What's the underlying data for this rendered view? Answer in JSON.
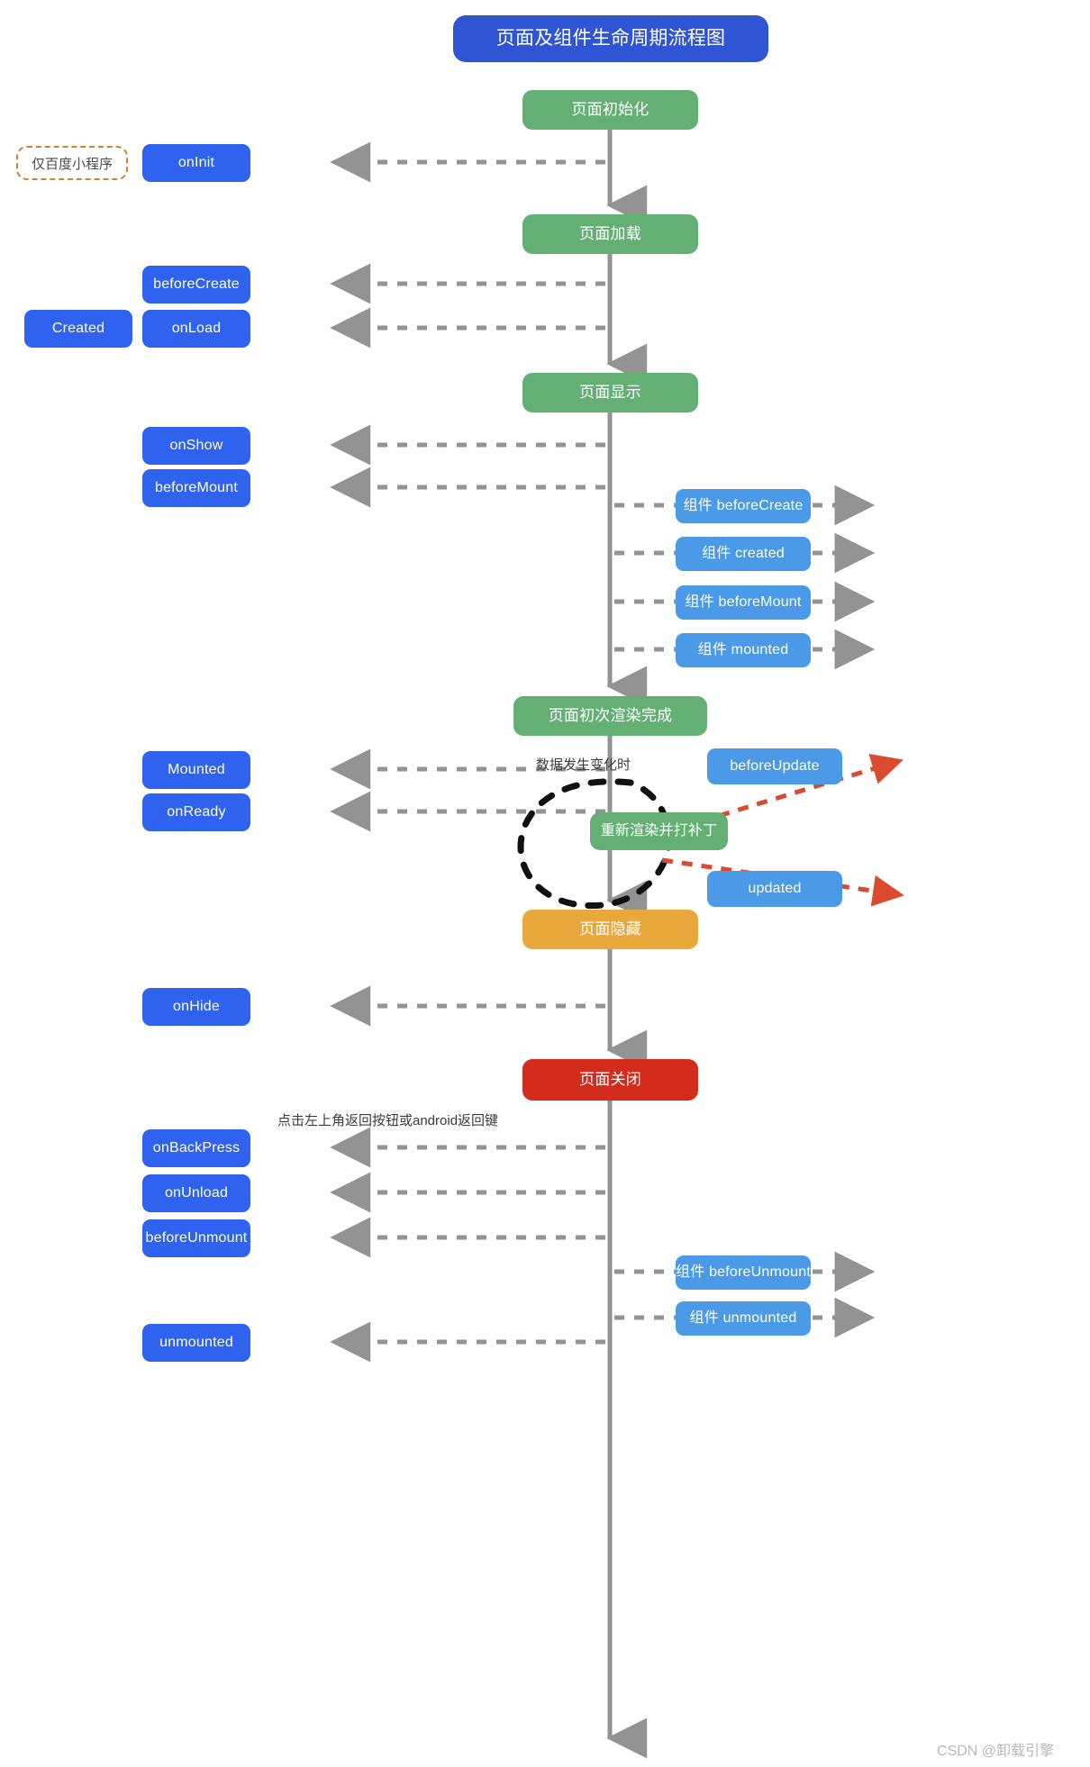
{
  "diagram": {
    "title": "页面及组件生命周期流程图",
    "watermark": "CSDN @卸载引擎"
  },
  "stages": [
    {
      "id": "page-init",
      "label": "页面初始化"
    },
    {
      "id": "page-load",
      "label": "页面加载"
    },
    {
      "id": "page-show",
      "label": "页面显示"
    },
    {
      "id": "page-first-render",
      "label": "页面初次渲染完成"
    },
    {
      "id": "page-hide",
      "label": "页面隐藏"
    },
    {
      "id": "page-close",
      "label": "页面关闭"
    }
  ],
  "rerender": {
    "label": "重新渲染并打补丁"
  },
  "hooks": [
    {
      "id": "oninit",
      "label": "onInit"
    },
    {
      "id": "beforecreate",
      "label": "beforeCreate"
    },
    {
      "id": "created",
      "label": "Created"
    },
    {
      "id": "onload",
      "label": "onLoad"
    },
    {
      "id": "onshow",
      "label": "onShow"
    },
    {
      "id": "beforemount",
      "label": "beforeMount"
    },
    {
      "id": "mounted",
      "label": "Mounted"
    },
    {
      "id": "onready",
      "label": "onReady"
    },
    {
      "id": "onhide",
      "label": "onHide"
    },
    {
      "id": "onbackpress",
      "label": "onBackPress"
    },
    {
      "id": "onunload",
      "label": "onUnload"
    },
    {
      "id": "beforeunmount",
      "label": "beforeUnmount"
    },
    {
      "id": "unmounted",
      "label": "unmounted"
    },
    {
      "id": "beforeupdate",
      "label": "beforeUpdate"
    },
    {
      "id": "updated",
      "label": "updated"
    }
  ],
  "components": [
    {
      "id": "comp-beforecreate",
      "label": "组件 beforeCreate"
    },
    {
      "id": "comp-created",
      "label": "组件 created"
    },
    {
      "id": "comp-beforemount",
      "label": "组件 beforeMount"
    },
    {
      "id": "comp-mounted",
      "label": "组件 mounted"
    },
    {
      "id": "comp-beforeunmount",
      "label": "组件 beforeUnmount"
    },
    {
      "id": "comp-unmounted",
      "label": "组件 unmounted"
    }
  ],
  "badges": [
    {
      "id": "baidu-only",
      "label": "仅百度小程序"
    }
  ],
  "annotations": [
    {
      "id": "data-change",
      "label": "数据发生变化时"
    },
    {
      "id": "back-trigger",
      "label": "点击左上角返回按钮或android返回键"
    }
  ],
  "colors": {
    "title_bg": "#2f55d4",
    "stage_bg": "#64b074",
    "stage_warn_bg": "#e9a83c",
    "stage_danger_bg": "#d32b1c",
    "hook_bg": "#2f63ef",
    "component_bg": "#4a9ae8",
    "badge_border": "#d4822a",
    "flow_line": "#939393",
    "loop_line": "#111111",
    "update_arrow": "#d94a2e",
    "watermark": "#b9b9b9"
  }
}
